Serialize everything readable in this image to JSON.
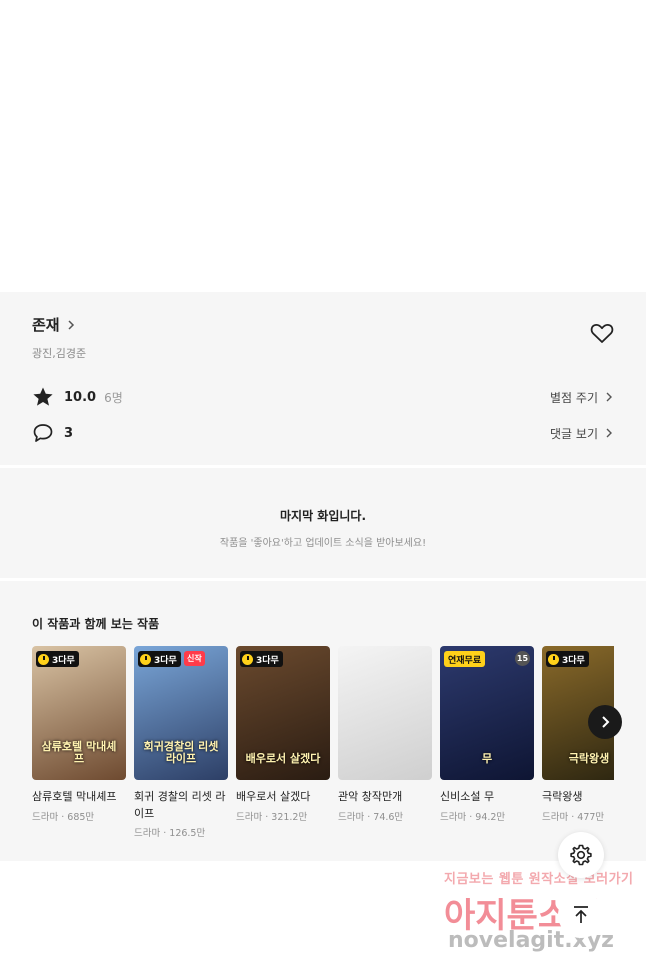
{
  "work": {
    "title": "존재",
    "authors": "광진,김경준",
    "rating": "10.0",
    "rating_count": "6명",
    "rate_link": "별점 주기",
    "comments": "3",
    "comments_link": "댓글 보기"
  },
  "last_episode": {
    "title": "마지막 화입니다.",
    "subtitle": "작품을 '좋아요'하고 업데이트 소식을 받아보세요!"
  },
  "recommendations": {
    "title": "이 작품과 함께 보는 작품",
    "items": [
      {
        "title": "삼류호텔 막내셰프",
        "meta": "드라마 · 685만",
        "badge": "3다무",
        "cover": "삼류호텔 막내셰프",
        "color1": "#d9c3a4",
        "color2": "#6e4a30"
      },
      {
        "title": "회귀 경찰의 리셋 라이프",
        "meta": "드라마 · 126.5만",
        "badge": "3다무",
        "new": "신작",
        "cover": "회귀경찰의 리셋라이프",
        "color1": "#7aa6d8",
        "color2": "#2d3f66"
      },
      {
        "title": "배우로서 살겠다",
        "meta": "드라마 · 321.2만",
        "badge": "3다무",
        "cover": "배우로서 살겠다",
        "color1": "#6b4a2e",
        "color2": "#2a1c12"
      },
      {
        "title": "관악 창작만개",
        "meta": "드라마 · 74.6만",
        "badge": "",
        "cover": "",
        "color1": "#f4f4f4",
        "color2": "#cfcfcf"
      },
      {
        "title": "신비소설 무",
        "meta": "드라마 · 94.2만",
        "badge": "연재무료",
        "age": "15",
        "cover": "무",
        "color1": "#2d3a6e",
        "color2": "#0e1533"
      },
      {
        "title": "극락왕생",
        "meta": "드라마 · 477만",
        "badge": "3다무",
        "cover": "극락왕생",
        "color1": "#8a6a2a",
        "color2": "#2a2410"
      }
    ]
  },
  "watermark": {
    "line1": "지금보는 웹툰 원작소설 보러가기",
    "line2": "아지툰소설",
    "line3": "novelagit.xyz"
  }
}
